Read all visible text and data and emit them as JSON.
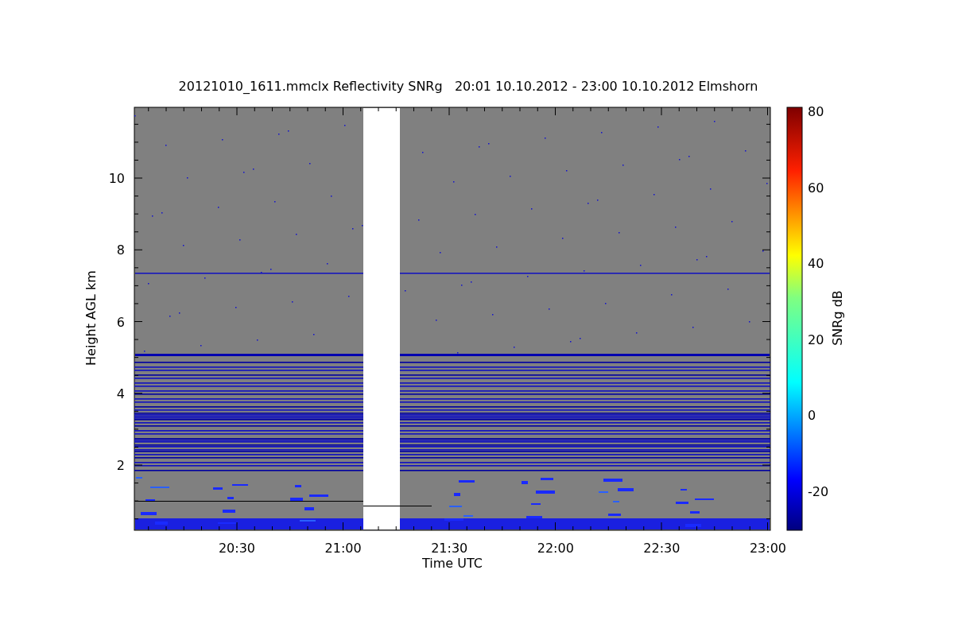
{
  "plot": {
    "title": "20121010_1611.mmclx Reflectivity SNRg   20:01 10.10.2012 - 23:00 10.10.2012 Elmshorn",
    "xlabel": "Time UTC",
    "ylabel": "Height AGL km",
    "xtick_labels": [
      "20:30",
      "21:00",
      "21:30",
      "22:00",
      "22:30",
      "23:00"
    ],
    "ytick_labels": [
      "10",
      "8",
      "6",
      "4",
      "2"
    ]
  },
  "colorbar": {
    "label": "SNRg dB",
    "tick_labels": [
      "80",
      "60",
      "40",
      "20",
      "0",
      "-20"
    ]
  }
}
